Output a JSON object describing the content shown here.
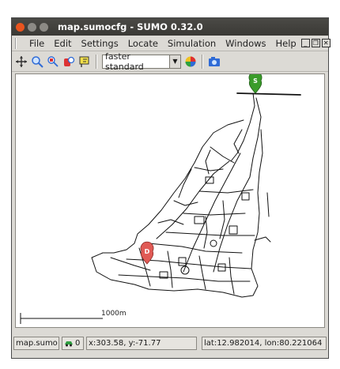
{
  "window": {
    "title": "map.sumocfg - SUMO 0.32.0"
  },
  "menu": {
    "items": [
      "File",
      "Edit",
      "Settings",
      "Locate",
      "Simulation",
      "Windows",
      "Help"
    ]
  },
  "toolbar": {
    "scheme_value": "faster standard"
  },
  "map": {
    "scale_label": "1000m",
    "start_marker": "S",
    "end_marker": "D"
  },
  "status": {
    "file": "map.sumo",
    "count": "0",
    "coords": "x:303.58, y:-71.77",
    "latlon": "lat:12.982014, lon:80.221064"
  },
  "colors": {
    "start_marker": "#3a9c2a",
    "end_marker": "#e05a55",
    "title_close": "#e9541f"
  }
}
